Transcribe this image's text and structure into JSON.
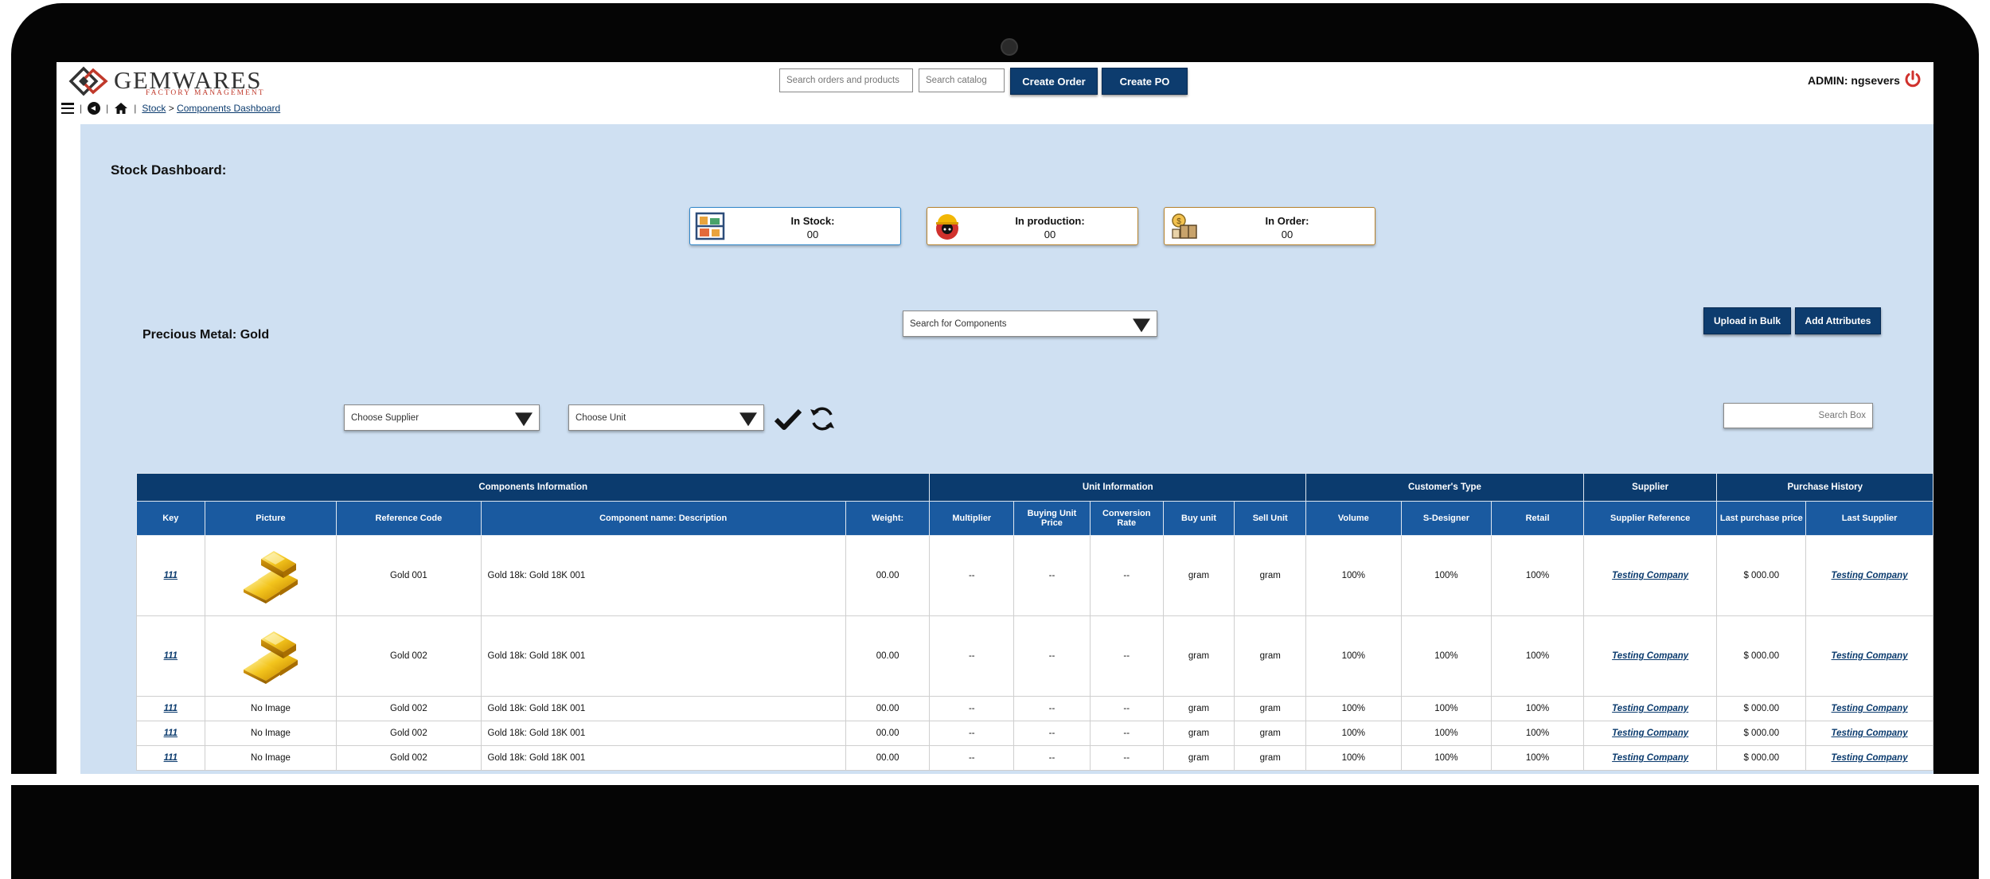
{
  "header": {
    "logo_text": "GEMWARES",
    "logo_subtext": "FACTORY MANAGEMENT",
    "breadcrumb": {
      "root": "Stock",
      "separator": ">",
      "current": "Components Dashboard"
    },
    "search_orders_placeholder": "Search orders and products",
    "search_catalog_placeholder": "Search catalog",
    "create_order_label": "Create Order",
    "create_po_label": "Create PO",
    "admin_label": "ADMIN: ngsevers"
  },
  "dashboard": {
    "title": "Stock Dashboard:",
    "cards": [
      {
        "label": "In Stock:",
        "value": "00",
        "border": "#2f86c9",
        "icon": "shelves-icon"
      },
      {
        "label": "In production:",
        "value": "00",
        "border": "#b5822d",
        "icon": "worker-icon"
      },
      {
        "label": "In Order:",
        "value": "00",
        "border": "#b5822d",
        "icon": "order-box-icon"
      }
    ]
  },
  "section": {
    "title": "Precious Metal: Gold",
    "component_search_placeholder": "Search for Components",
    "upload_bulk_label": "Upload in Bulk",
    "add_attributes_label": "Add Attributes",
    "supplier_placeholder": "Choose Supplier",
    "unit_placeholder": "Choose Unit",
    "search_box_placeholder": "Search Box"
  },
  "table": {
    "groups": [
      "Components Information",
      "Unit Information",
      "Customer's Type",
      "Supplier",
      "Purchase History"
    ],
    "columns": [
      "Key",
      "Picture",
      "Reference Code",
      "Component name: Description",
      "Weight:",
      "Multiplier",
      "Buying Unit Price",
      "Conversion Rate",
      "Buy unit",
      "Sell Unit",
      "Volume",
      "S-Designer",
      "Retail",
      "Supplier Reference",
      "Last purchase price",
      "Last Supplier"
    ],
    "rows": [
      {
        "key": "111",
        "picture": "",
        "ref": "Gold 001",
        "desc": "Gold 18k: Gold 18K 001",
        "weight": "00.00",
        "multiplier": "--",
        "buying_price": "--",
        "conversion": "--",
        "buy_unit": "gram",
        "sell_unit": "gram",
        "volume": "100%",
        "s_designer": "100%",
        "retail": "100%",
        "supplier_ref": "Testing Company",
        "last_price": "$ 000.00",
        "last_supplier": "Testing Company"
      },
      {
        "key": "111",
        "picture": "",
        "ref": "Gold 002",
        "desc": "Gold 18k: Gold 18K 001",
        "weight": "00.00",
        "multiplier": "--",
        "buying_price": "--",
        "conversion": "--",
        "buy_unit": "gram",
        "sell_unit": "gram",
        "volume": "100%",
        "s_designer": "100%",
        "retail": "100%",
        "supplier_ref": "Testing Company",
        "last_price": "$ 000.00",
        "last_supplier": "Testing Company"
      },
      {
        "key": "111",
        "picture": "No Image",
        "ref": "Gold 002",
        "desc": "Gold 18k: Gold 18K 001",
        "weight": "00.00",
        "multiplier": "--",
        "buying_price": "--",
        "conversion": "--",
        "buy_unit": "gram",
        "sell_unit": "gram",
        "volume": "100%",
        "s_designer": "100%",
        "retail": "100%",
        "supplier_ref": "Testing Company",
        "last_price": "$ 000.00",
        "last_supplier": "Testing Company"
      },
      {
        "key": "111",
        "picture": "No Image",
        "ref": "Gold 002",
        "desc": "Gold 18k: Gold 18K 001",
        "weight": "00.00",
        "multiplier": "--",
        "buying_price": "--",
        "conversion": "--",
        "buy_unit": "gram",
        "sell_unit": "gram",
        "volume": "100%",
        "s_designer": "100%",
        "retail": "100%",
        "supplier_ref": "Testing Company",
        "last_price": "$ 000.00",
        "last_supplier": "Testing Company"
      },
      {
        "key": "111",
        "picture": "No Image",
        "ref": "Gold 002",
        "desc": "Gold 18k: Gold 18K 001",
        "weight": "00.00",
        "multiplier": "--",
        "buying_price": "--",
        "conversion": "--",
        "buy_unit": "gram",
        "sell_unit": "gram",
        "volume": "100%",
        "s_designer": "100%",
        "retail": "100%",
        "supplier_ref": "Testing Company",
        "last_price": "$ 000.00",
        "last_supplier": "Testing Company"
      }
    ]
  },
  "colors": {
    "primary": "#0b3b6e",
    "header_row": "#1a5aa0",
    "main_bg": "#cfe0f2",
    "logout_red": "#d0312d"
  }
}
